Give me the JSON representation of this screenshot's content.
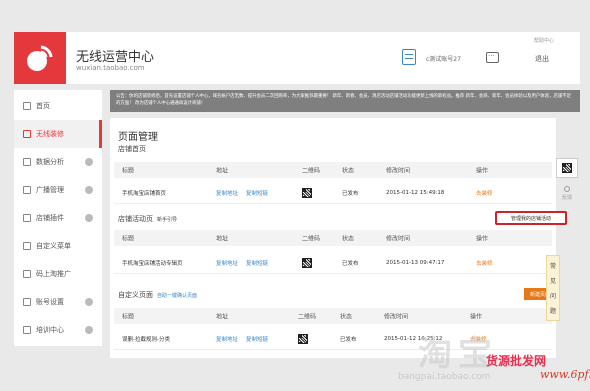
{
  "header": {
    "title": "无线运营中心",
    "subtitle": "wuxian.taobao.com",
    "account": "c测试账号27",
    "help": "帮助中心",
    "logout": "退出"
  },
  "sidebar": {
    "items": [
      {
        "label": "首页"
      },
      {
        "label": "无线装修"
      },
      {
        "label": "数据分析"
      },
      {
        "label": "广播管理"
      },
      {
        "label": "店铺插件"
      },
      {
        "label": "自定义菜单"
      },
      {
        "label": "码上淘推广"
      },
      {
        "label": "账号设置"
      },
      {
        "label": "培训中心"
      }
    ]
  },
  "notice": {
    "text": "公告：你的店铺装修后，首先设置店铺个人中心，域名帐户店无数、提升会员二次回购率，为大家推荐最重要！ 新年、新春、会员、清店活动店铺活动功能更新上线的新权益。推荐 新年、会商、新年、会员体验以及用户体验，店铺不足的方面！ 改为店铺个人中心通通再设计商铺！"
  },
  "main": {
    "title": "页面管理",
    "columns": {
      "title": "标题",
      "address": "地址",
      "qrcode": "二维码",
      "status": "状态",
      "modified": "修改时间",
      "action": "操作"
    },
    "sections": [
      {
        "label": "店铺首页",
        "link": "",
        "rows": [
          {
            "title": "手机淘宝店铺首页",
            "copy_address": "复制地址",
            "copy_link": "复制短链",
            "status": "已发布",
            "modified": "2015-01-12 15:49:18",
            "action": "去装修"
          }
        ]
      },
      {
        "label": "店铺活动页",
        "link": "新手引导",
        "rows": [
          {
            "title": "手机淘宝店铺活动专辑页",
            "copy_address": "复制地址",
            "copy_link": "复制短链",
            "status": "已发布",
            "modified": "2015-01-13 09:47:17",
            "action": "去装修"
          }
        ]
      },
      {
        "label": "自定义页面",
        "link": "自助一键确认页面",
        "rows": [
          {
            "title": "误删-拉截规则-分类",
            "copy_address": "复制地址",
            "copy_link": "复制短链",
            "status": "已发布",
            "modified": "2015-01-12 16:25:12",
            "action": "去装修"
          }
        ]
      }
    ],
    "manage_button": "管理我的店铺活动",
    "new_button": "新建页面"
  },
  "right_panel": {
    "feedback": "反馈",
    "faq_chars": [
      "常",
      "见",
      "问",
      "题"
    ]
  },
  "watermark": {
    "big": "淘宝",
    "brand": "bangpai.taobao.com",
    "cn": "货源批发网",
    "url": "www.6pf.cn"
  }
}
